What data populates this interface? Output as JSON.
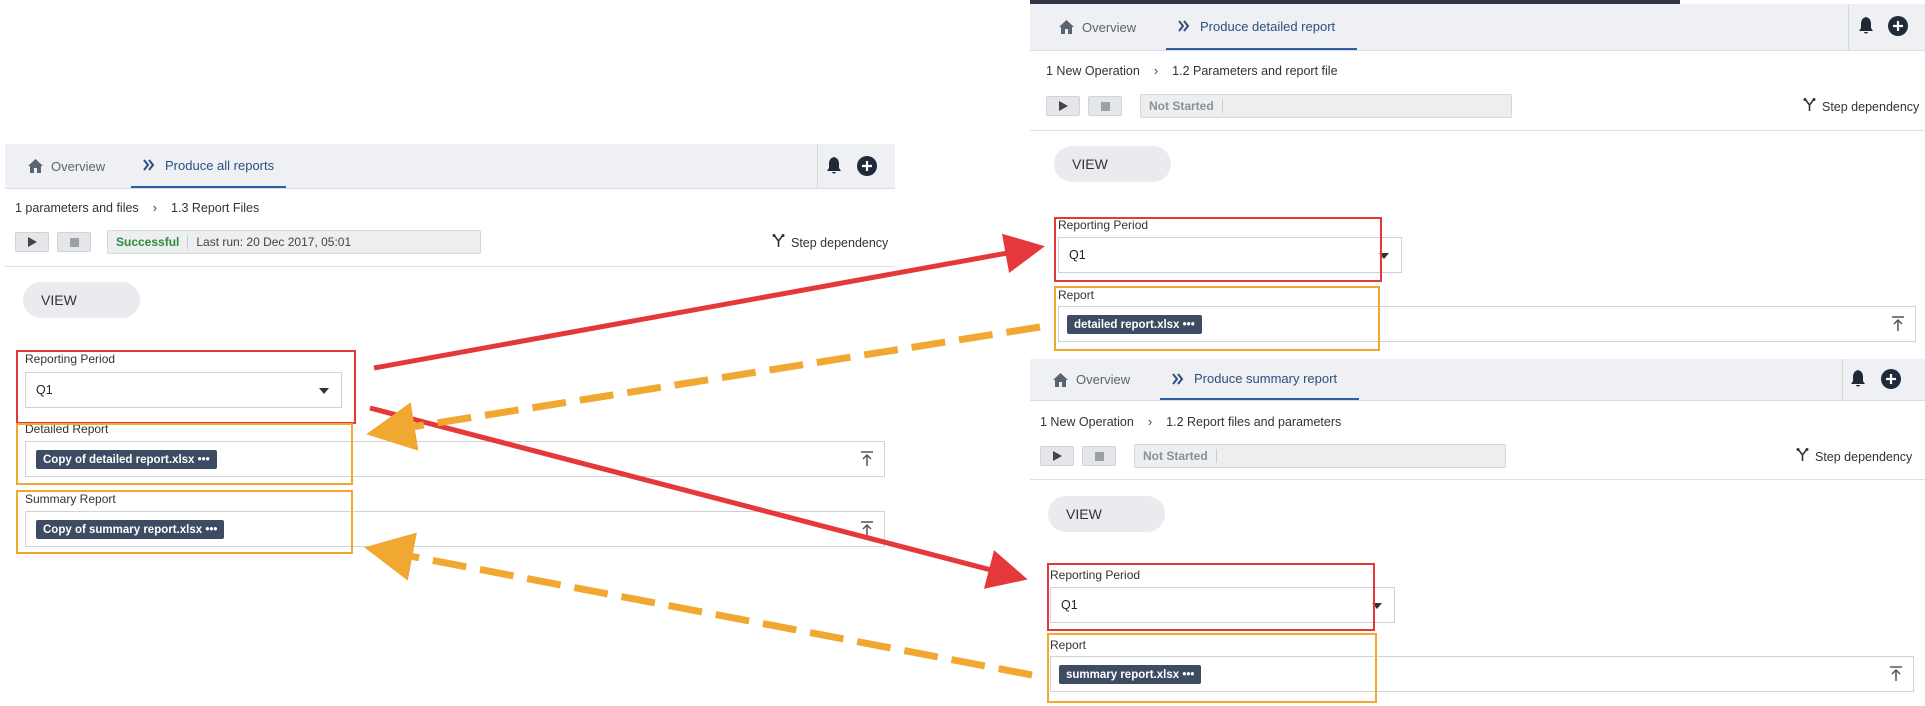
{
  "left_panel": {
    "tabs": [
      {
        "label": "Overview",
        "icon": "home-icon"
      },
      {
        "label": "Produce all reports",
        "icon": "double-chevron-right-icon"
      }
    ],
    "breadcrumb": [
      "1 parameters and files",
      "1.3 Report Files"
    ],
    "status": {
      "state": "Successful",
      "last_run": "Last run: 20 Dec 2017, 05:01",
      "state_color": "#2e8b3a"
    },
    "step_dependency": "Step dependency",
    "view_button": "VIEW",
    "fields": {
      "period_label": "Reporting Period",
      "period_value": "Q1",
      "detailed_label": "Detailed Report",
      "detailed_file": "Copy of detailed report.xlsx •••",
      "summary_label": "Summary Report",
      "summary_file": "Copy of summary report.xlsx •••"
    }
  },
  "right_top_panel": {
    "tabs": [
      {
        "label": "Overview",
        "icon": "home-icon"
      },
      {
        "label": "Produce detailed report",
        "icon": "double-chevron-right-icon"
      }
    ],
    "breadcrumb": [
      "1 New Operation",
      "1.2 Parameters and report file"
    ],
    "status": {
      "state": "Not Started"
    },
    "step_dependency": "Step dependency",
    "view_button": "VIEW",
    "fields": {
      "period_label": "Reporting Period",
      "period_value": "Q1",
      "report_label": "Report",
      "report_file": "detailed report.xlsx •••"
    }
  },
  "right_bottom_panel": {
    "tabs": [
      {
        "label": "Overview",
        "icon": "home-icon"
      },
      {
        "label": "Produce summary report",
        "icon": "double-chevron-right-icon"
      }
    ],
    "breadcrumb": [
      "1 New Operation",
      "1.2 Report files and parameters"
    ],
    "status": {
      "state": "Not Started"
    },
    "step_dependency": "Step dependency",
    "view_button": "VIEW",
    "fields": {
      "period_label": "Reporting Period",
      "period_value": "Q1",
      "report_label": "Report",
      "report_file": "summary report.xlsx •••"
    }
  },
  "colors": {
    "highlight_red": "#e5383b",
    "highlight_orange": "#f0a830",
    "accent_blue": "#2e5ca8",
    "chip_bg": "#3d4b63"
  }
}
